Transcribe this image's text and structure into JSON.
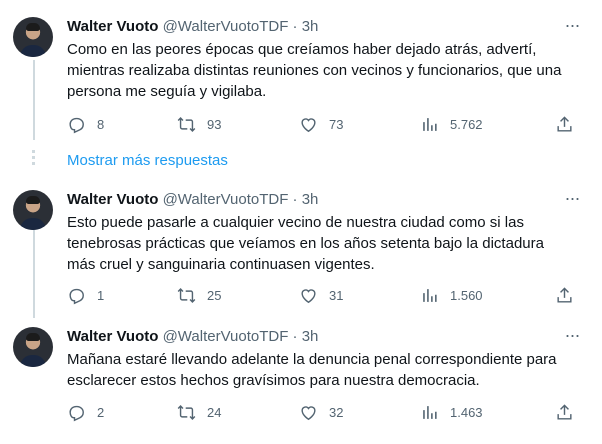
{
  "show_more_label": "Mostrar más respuestas",
  "tweets": [
    {
      "name": "Walter Vuoto",
      "handle": "@WalterVuotoTDF",
      "sep": "·",
      "time": "3h",
      "text": "Como en las peores épocas que creíamos haber dejado atrás, advertí, mientras realizaba distintas reuniones con vecinos y funcionarios, que una persona me seguía y vigilaba.",
      "replies": "8",
      "retweets": "93",
      "likes": "73",
      "views": "5.762"
    },
    {
      "name": "Walter Vuoto",
      "handle": "@WalterVuotoTDF",
      "sep": "·",
      "time": "3h",
      "text": "Esto puede pasarle a cualquier vecino de nuestra ciudad como si las tenebrosas prácticas que veíamos en los años setenta bajo la dictadura más cruel y sanguinaria continuasen vigentes.",
      "replies": "1",
      "retweets": "25",
      "likes": "31",
      "views": "1.560"
    },
    {
      "name": "Walter Vuoto",
      "handle": "@WalterVuotoTDF",
      "sep": "·",
      "time": "3h",
      "text": "Mañana estaré llevando adelante la denuncia penal correspondiente para esclarecer estos hechos gravísimos para nuestra democracia.",
      "replies": "2",
      "retweets": "24",
      "likes": "32",
      "views": "1.463"
    }
  ],
  "icons": {
    "reply": "reply-icon",
    "retweet": "retweet-icon",
    "like": "heart-icon",
    "views": "views-icon",
    "share": "share-icon",
    "more": "more-icon"
  },
  "colors": {
    "text": "#0f1419",
    "secondary": "#536471",
    "link": "#1d9bf0",
    "thread_line": "#cfd9de"
  }
}
